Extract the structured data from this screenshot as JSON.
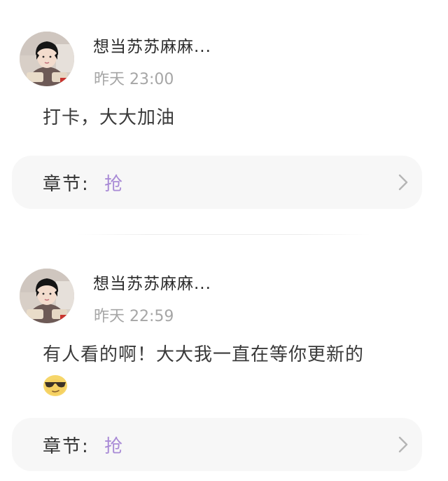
{
  "comments": [
    {
      "username": "想当苏苏麻麻...",
      "time": "昨天 23:00",
      "content": "打卡，大大加油",
      "chapter_label": "章节:",
      "chapter_value": "抢"
    },
    {
      "username": "想当苏苏麻麻...",
      "time": "昨天 22:59",
      "content": "有人看的啊！大大我一直在等你更新的",
      "emoji": "cool-sunglasses-emoji",
      "chapter_label": "章节:",
      "chapter_value": "抢"
    }
  ],
  "colors": {
    "accent": "#a98bd6",
    "card_bg": "#f7f7f7",
    "time": "#a6a6a6"
  }
}
